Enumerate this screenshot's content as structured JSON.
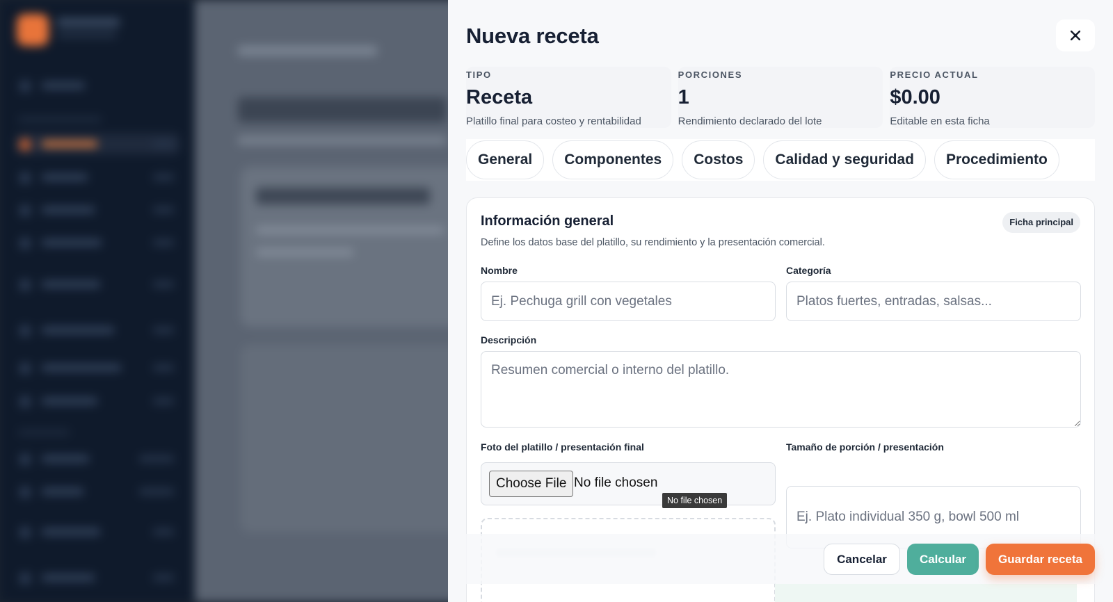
{
  "modal": {
    "title": "Nueva receta",
    "close_icon": "close-icon"
  },
  "stats": [
    {
      "label": "TIPO",
      "value": "Receta",
      "hint": "Platillo final para costeo y rentabilidad"
    },
    {
      "label": "PORCIONES",
      "value": "1",
      "hint": "Rendimiento declarado del lote"
    },
    {
      "label": "PRECIO ACTUAL",
      "value": "$0.00",
      "hint": "Editable en esta ficha"
    }
  ],
  "tabs": [
    "General",
    "Componentes",
    "Costos",
    "Calidad y seguridad",
    "Procedimiento"
  ],
  "panel": {
    "title": "Información general",
    "badge": "Ficha principal",
    "description": "Define los datos base del platillo, su rendimiento y la presentación comercial."
  },
  "form": {
    "nombre": {
      "label": "Nombre",
      "placeholder": "Ej. Pechuga grill con vegetales",
      "value": ""
    },
    "categoria": {
      "label": "Categoría",
      "placeholder": "Platos fuertes, entradas, salsas...",
      "value": ""
    },
    "descripcion": {
      "label": "Descripción",
      "placeholder": "Resumen comercial o interno del platillo.",
      "value": ""
    },
    "foto": {
      "label": "Foto del platillo / presentación final",
      "button": "Choose File",
      "status": "No file chosen",
      "tooltip": "No file chosen"
    },
    "porcion": {
      "label": "Tamaño de porción / presentación",
      "placeholder": "Ej. Plato individual 350 g, bowl 500 ml",
      "value": ""
    }
  },
  "footer": {
    "cancel": "Cancelar",
    "calc": "Calcular",
    "save": "Guardar receta"
  },
  "colors": {
    "accent_orange": "#f0743a",
    "accent_teal": "#4fae9c",
    "sidebar": "#0f1a2b"
  }
}
